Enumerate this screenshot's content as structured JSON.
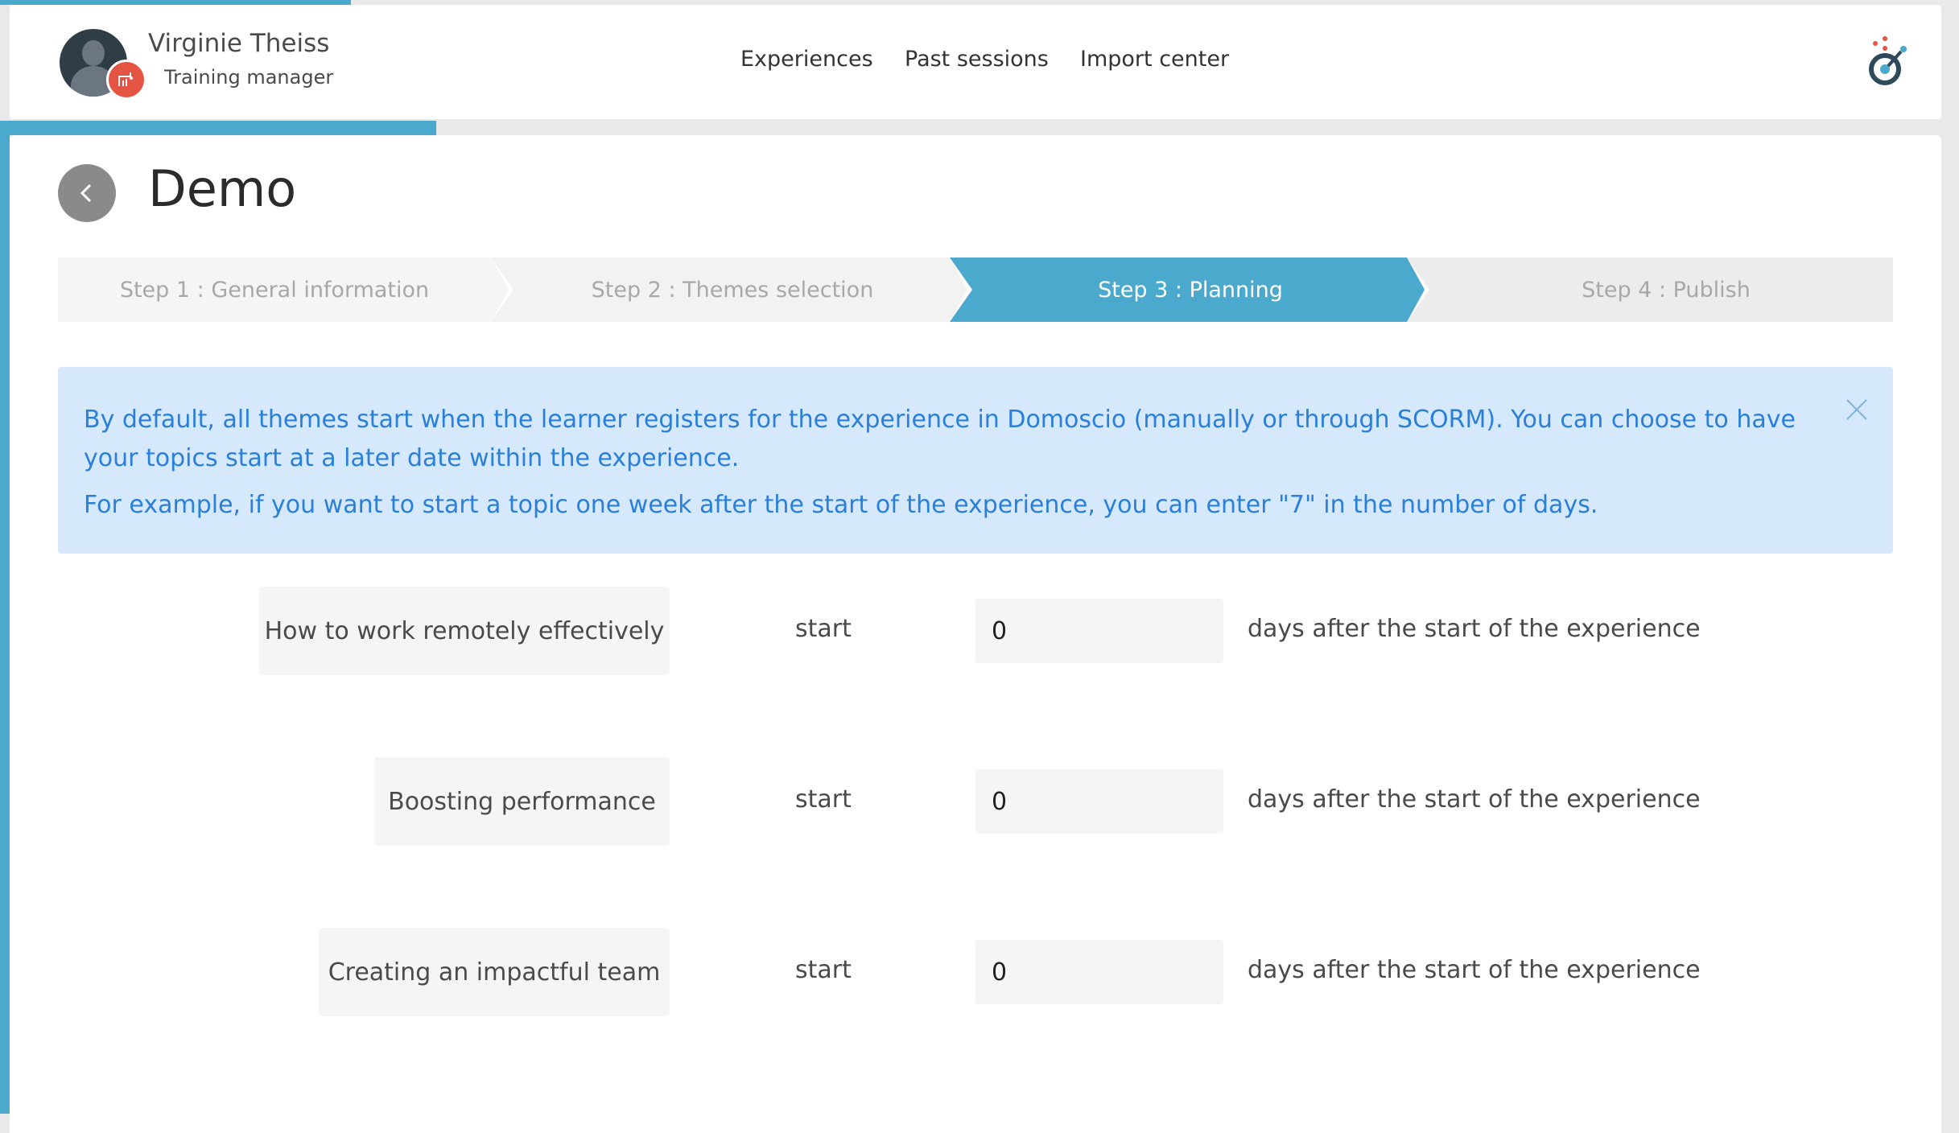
{
  "colors": {
    "accent": "#4aa9cc",
    "info_bg": "#d6e8fb",
    "info_text": "#2a7fd8",
    "badge": "#e45442"
  },
  "user": {
    "name": "Virginie Theiss",
    "role": "Training manager",
    "avatar_icon": "user-avatar-icon",
    "badge_icon": "presentation-board-icon"
  },
  "nav": {
    "experiences": "Experiences",
    "past_sessions": "Past sessions",
    "import_center": "Import center"
  },
  "logo_icon": "domoscio-logo-icon",
  "page": {
    "title": "Demo",
    "back_icon": "chevron-left-icon"
  },
  "steps": [
    {
      "label": "Step 1 : General information",
      "active": false
    },
    {
      "label": "Step 2 : Themes selection",
      "active": false
    },
    {
      "label": "Step 3 : Planning",
      "active": true
    },
    {
      "label": "Step 4 : Publish",
      "active": false
    }
  ],
  "info": {
    "paragraph_1": "By default, all themes start when the learner registers for the experience in Domoscio (manually or through SCORM). You can choose to have your topics start at a later date within the experience.",
    "paragraph_2": "For example, if you want to start a topic one week after the start of the experience, you can enter \"7\" in the number of days.",
    "close_icon": "close-icon"
  },
  "planning": {
    "rows": [
      {
        "theme": "How to work remotely effectively",
        "start_label": "start",
        "days": "0",
        "suffix": "days after the start of the experience"
      },
      {
        "theme": "Boosting performance",
        "start_label": "start",
        "days": "0",
        "suffix": "days after the start of the experience"
      },
      {
        "theme": "Creating an impactful team",
        "start_label": "start",
        "days": "0",
        "suffix": "days after the start of the experience"
      }
    ]
  }
}
